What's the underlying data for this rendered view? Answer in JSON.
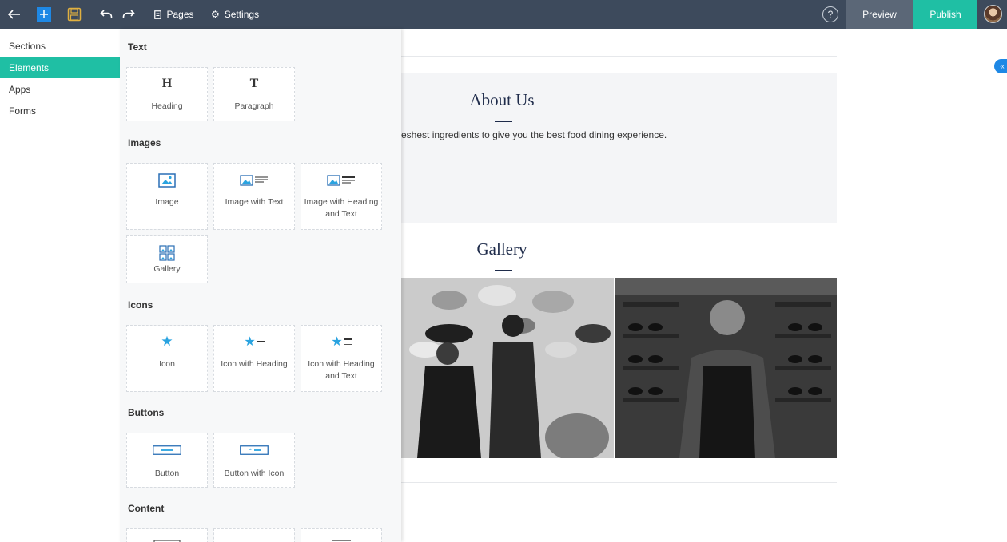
{
  "toolbar": {
    "pages_label": "Pages",
    "settings_label": "Settings",
    "preview_label": "Preview",
    "publish_label": "Publish",
    "help_label": "?"
  },
  "leftnav": {
    "items": [
      {
        "label": "Sections"
      },
      {
        "label": "Elements",
        "active": true
      },
      {
        "label": "Apps"
      },
      {
        "label": "Forms"
      }
    ]
  },
  "panel": {
    "text": {
      "title": "Text",
      "heading": {
        "label": "Heading",
        "glyph": "H"
      },
      "paragraph": {
        "label": "Paragraph",
        "glyph": "T"
      }
    },
    "images": {
      "title": "Images",
      "image": "Image",
      "image_with_text": "Image with Text",
      "image_with_heading_and_text": "Image with Heading and Text",
      "gallery": "Gallery"
    },
    "icons": {
      "title": "Icons",
      "icon": "Icon",
      "icon_with_heading": "Icon with Heading",
      "icon_with_heading_and_text": "Icon with Heading and Text"
    },
    "buttons": {
      "title": "Buttons",
      "button": "Button",
      "button_with_icon": "Button with Icon"
    },
    "content": {
      "title": "Content"
    }
  },
  "canvas": {
    "about_title": "About Us",
    "about_text": "eshest ingredients to give you the best food dining experience.",
    "gallery_title": "Gallery"
  },
  "colors": {
    "topbar": "#3d4a5c",
    "accent": "#1fbfa4",
    "icon_blue": "#29a3e0",
    "heading_navy": "#1e2b4a"
  }
}
